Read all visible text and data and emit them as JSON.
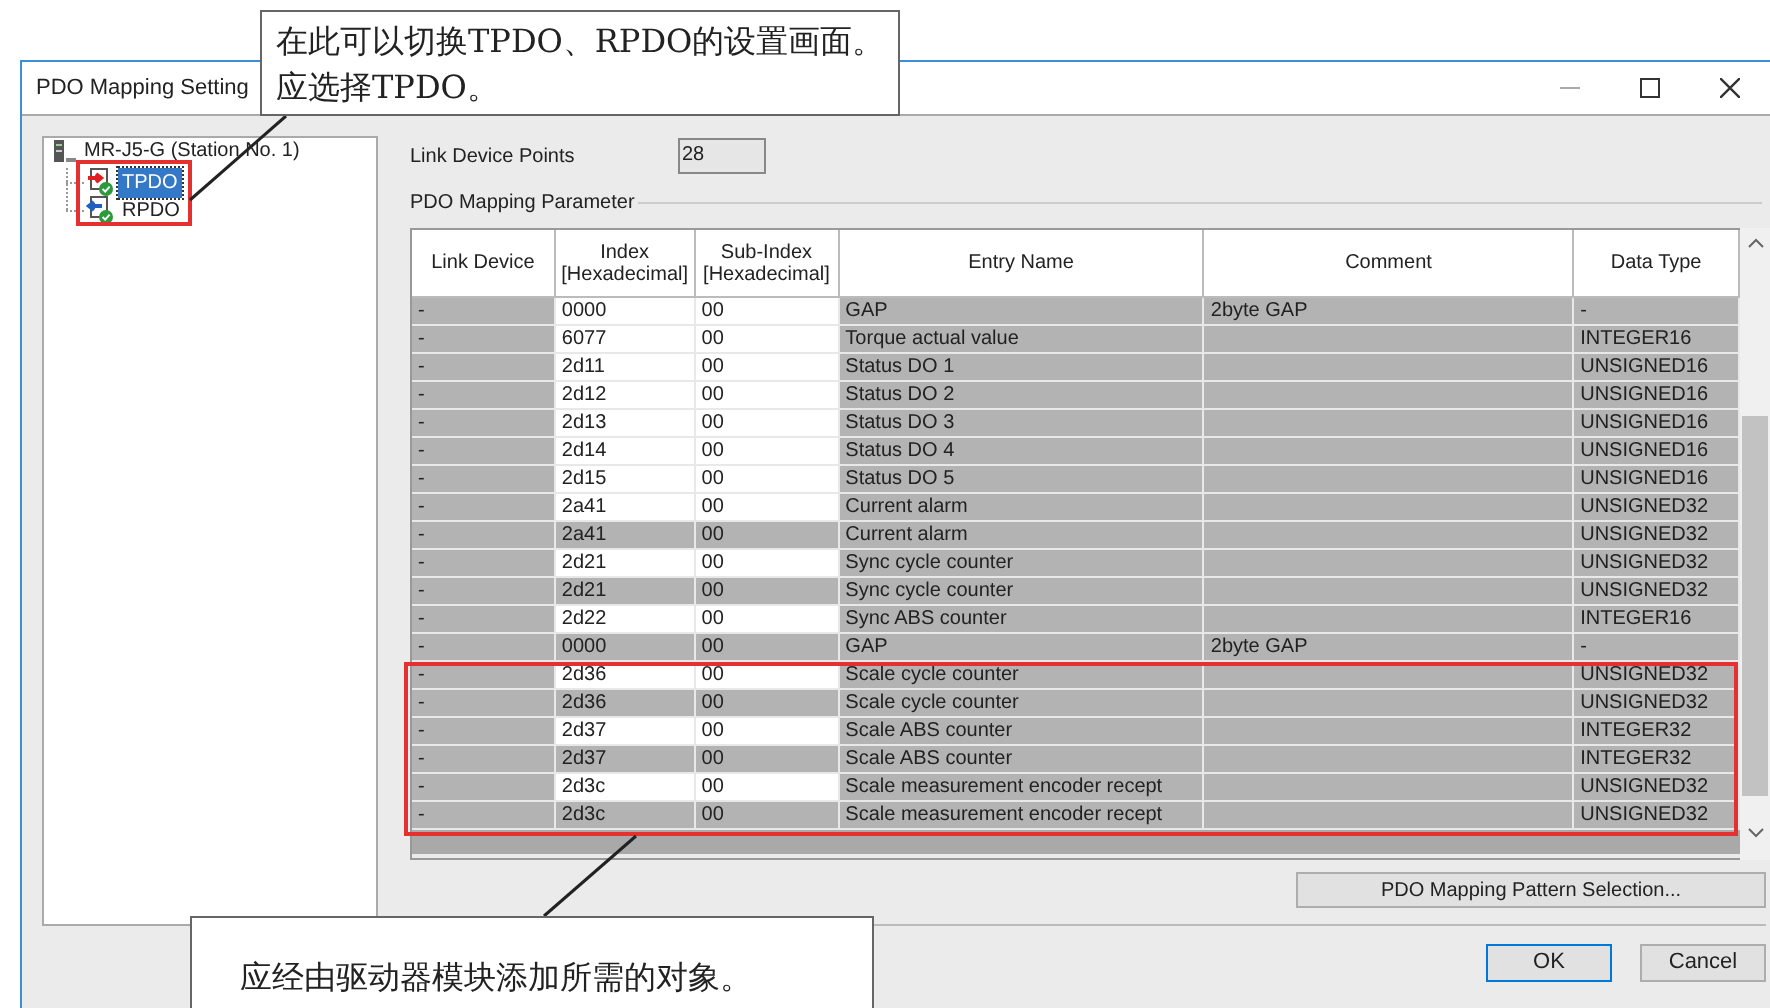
{
  "window": {
    "title": "PDO Mapping Setting"
  },
  "tree": {
    "label": "MR-J5-G (Station No. 1)",
    "expanded": true,
    "children": [
      {
        "label": "TPDO",
        "selected": true,
        "kind": "transmit"
      },
      {
        "label": "RPDO",
        "selected": false,
        "kind": "receive"
      }
    ]
  },
  "link_device_points": {
    "label": "Link Device Points",
    "value": "28"
  },
  "group_label": "PDO Mapping Parameter",
  "table": {
    "columns": [
      "Link Device",
      "Index\n[Hexadecimal]",
      "Sub-Index\n[Hexadecimal]",
      "Entry Name",
      "Comment",
      "Data Type"
    ],
    "rows": [
      {
        "cells": [
          "-",
          "0000",
          "00",
          "GAP",
          "2byte GAP",
          "-"
        ],
        "shaded": false
      },
      {
        "cells": [
          "-",
          "6077",
          "00",
          "Torque actual value",
          "",
          "INTEGER16"
        ],
        "shaded": false
      },
      {
        "cells": [
          "-",
          "2d11",
          "00",
          "Status DO 1",
          "",
          "UNSIGNED16"
        ],
        "shaded": false
      },
      {
        "cells": [
          "-",
          "2d12",
          "00",
          "Status DO 2",
          "",
          "UNSIGNED16"
        ],
        "shaded": false
      },
      {
        "cells": [
          "-",
          "2d13",
          "00",
          "Status DO 3",
          "",
          "UNSIGNED16"
        ],
        "shaded": false
      },
      {
        "cells": [
          "-",
          "2d14",
          "00",
          "Status DO 4",
          "",
          "UNSIGNED16"
        ],
        "shaded": false
      },
      {
        "cells": [
          "-",
          "2d15",
          "00",
          "Status DO 5",
          "",
          "UNSIGNED16"
        ],
        "shaded": false
      },
      {
        "cells": [
          "-",
          "2a41",
          "00",
          "Current alarm",
          "",
          "UNSIGNED32"
        ],
        "shaded": false
      },
      {
        "cells": [
          "-",
          "2a41",
          "00",
          "Current alarm",
          "",
          "UNSIGNED32"
        ],
        "shaded": true
      },
      {
        "cells": [
          "-",
          "2d21",
          "00",
          "Sync cycle counter",
          "",
          "UNSIGNED32"
        ],
        "shaded": false
      },
      {
        "cells": [
          "-",
          "2d21",
          "00",
          "Sync cycle counter",
          "",
          "UNSIGNED32"
        ],
        "shaded": true
      },
      {
        "cells": [
          "-",
          "2d22",
          "00",
          "Sync ABS counter",
          "",
          "INTEGER16"
        ],
        "shaded": false
      },
      {
        "cells": [
          "-",
          "0000",
          "00",
          "GAP",
          "2byte GAP",
          "-"
        ],
        "shaded": true
      },
      {
        "cells": [
          "-",
          "2d36",
          "00",
          "Scale cycle counter",
          "",
          "UNSIGNED32"
        ],
        "shaded": false
      },
      {
        "cells": [
          "-",
          "2d36",
          "00",
          "Scale cycle counter",
          "",
          "UNSIGNED32"
        ],
        "shaded": true
      },
      {
        "cells": [
          "-",
          "2d37",
          "00",
          "Scale ABS counter",
          "",
          "INTEGER32"
        ],
        "shaded": false
      },
      {
        "cells": [
          "-",
          "2d37",
          "00",
          "Scale ABS counter",
          "",
          "INTEGER32"
        ],
        "shaded": true
      },
      {
        "cells": [
          "-",
          "2d3c",
          "00",
          "Scale measurement encoder recept",
          "",
          "UNSIGNED32"
        ],
        "shaded": false
      },
      {
        "cells": [
          "-",
          "2d3c",
          "00",
          "Scale measurement encoder recept",
          "",
          "UNSIGNED32"
        ],
        "shaded": true
      }
    ]
  },
  "pattern_button": "PDO Mapping Pattern Selection...",
  "buttons": [
    {
      "label": "OK",
      "default": true
    },
    {
      "label": "Cancel",
      "default": false
    }
  ],
  "callouts": [
    {
      "lines": [
        "在此可以切换TPDO、RPDO的设置画面。",
        "应选择TPDO。"
      ]
    },
    {
      "lines": [
        "应经由驱动器模块添加所需的对象。"
      ]
    }
  ]
}
